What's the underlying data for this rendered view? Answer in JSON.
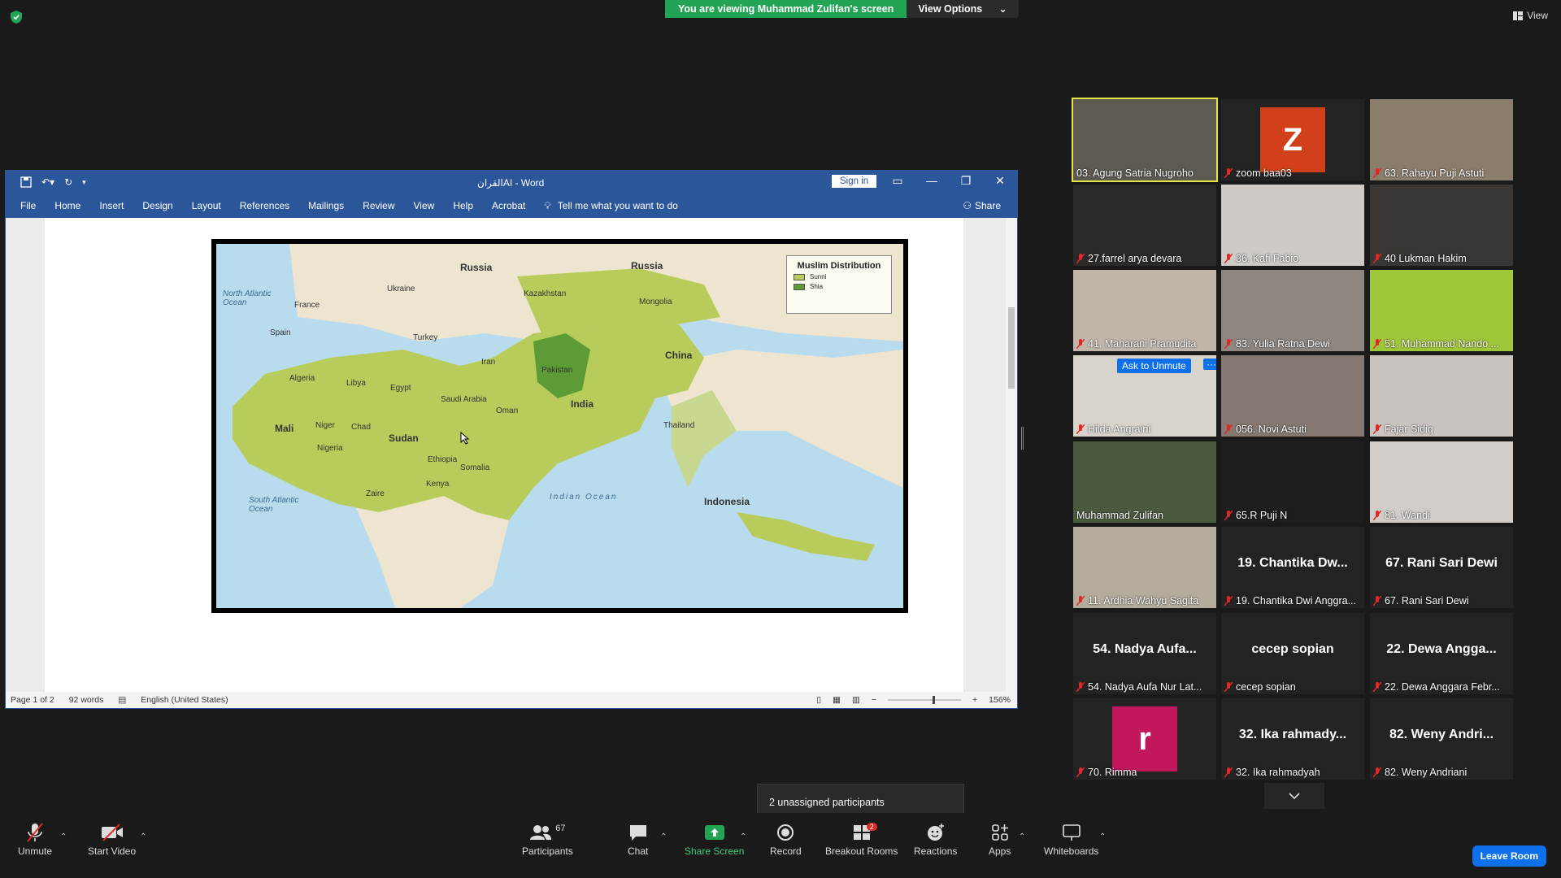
{
  "zoom": {
    "banner": "You are viewing Muhammad Zulifan's screen",
    "view_options": "View Options",
    "view_label": "View",
    "unassigned": "2 unassigned participants"
  },
  "word": {
    "title": "القرانAI  -  Word",
    "sign_in": "Sign in",
    "tabs": [
      "File",
      "Home",
      "Insert",
      "Design",
      "Layout",
      "References",
      "Mailings",
      "Review",
      "View",
      "Help",
      "Acrobat"
    ],
    "tell_me": "Tell me what you want to do",
    "share": "Share",
    "status": {
      "page": "Page 1 of 2",
      "words": "92 words",
      "language": "English (United States)",
      "zoom": "156%"
    },
    "map": {
      "legend_title": "Muslim Distribution",
      "legend_items": [
        {
          "label": "Sunni",
          "color": "#b7cc5a"
        },
        {
          "label": "Shia",
          "color": "#5c9b36"
        }
      ],
      "labels": {
        "russia1": "Russia",
        "russia2": "Russia",
        "kazakhstan": "Kazakhstan",
        "mongolia": "Mongolia",
        "china": "China",
        "ukraine": "Ukraine",
        "turkey": "Turkey",
        "iran": "Iran",
        "saudi": "Saudi Arabia",
        "india": "India",
        "algeria": "Algeria",
        "libya": "Libya",
        "egypt": "Egypt",
        "mali": "Mali",
        "niger": "Niger",
        "chad": "Chad",
        "sudan": "Sudan",
        "ethiopia": "Ethiopia",
        "somalia": "Somalia",
        "zaire": "Zaire",
        "indonesia": "Indonesia",
        "indian_ocean": "Indian Ocean",
        "north_atlantic": "North Atlantic Ocean",
        "south_atlantic": "South Atlantic Ocean",
        "thailand": "Thailand",
        "nigeria": "Nigeria",
        "oman": "Oman",
        "pakistan": "Pakistan",
        "spain": "Spain",
        "france": "France",
        "kenya": "Kenya"
      }
    }
  },
  "participants": [
    {
      "name": "03. Agung Satria Nugroho",
      "muted": false,
      "active": true,
      "video": "#5e5a52"
    },
    {
      "name": "zoom baa03",
      "muted": true,
      "avatar": "Z",
      "avatar_color": "#d1401a"
    },
    {
      "name": "63. Rahayu Puji Astuti",
      "muted": true,
      "video": "#8b7d6c"
    },
    {
      "name": "27.farrel arya devara",
      "muted": true,
      "video": "#2c2a29"
    },
    {
      "name": "36. Kafi Fabio",
      "muted": true,
      "video": "#cfcac6"
    },
    {
      "name": "40 Lukman Hakim",
      "muted": true,
      "video": "#3a3633"
    },
    {
      "name": "41. Maharani Pramudita",
      "muted": true,
      "video": "#c2b6aa"
    },
    {
      "name": "83. Yulia Ratna Dewi",
      "muted": true,
      "video": "#8e8680"
    },
    {
      "name": "51. Muhammad Nando ...",
      "muted": true,
      "video": "#9fc73a"
    },
    {
      "name": "Hilda Angraini",
      "muted": true,
      "video": "#d8d4cc",
      "ask": "Ask to Unmute",
      "ask_more": "···"
    },
    {
      "name": "056. Novi Astuti",
      "muted": true,
      "video": "#857870"
    },
    {
      "name": "Fajar Sidiq",
      "muted": true,
      "video": "#cac4c1"
    },
    {
      "name": "Muhammad Zulifan",
      "muted": false,
      "video": "#4b5a3e"
    },
    {
      "name": "65.R Puji N",
      "muted": true,
      "video": "#1e1e1e"
    },
    {
      "name": "81. Wandi",
      "muted": true,
      "video": "#d2ccc9"
    },
    {
      "name": "11. Ardhia Wahyu Sagita",
      "muted": true,
      "video": "#b3ab9b"
    },
    {
      "name": "19. Chantika Dwi Anggra...",
      "muted": true,
      "big": "19. Chantika Dw..."
    },
    {
      "name": "67. Rani Sari Dewi",
      "muted": true,
      "big": "67. Rani Sari Dewi"
    },
    {
      "name": "54. Nadya Aufa Nur Lat...",
      "muted": true,
      "big": "54. Nadya Aufa..."
    },
    {
      "name": "cecep sopian",
      "muted": true,
      "big": "cecep sopian"
    },
    {
      "name": "22. Dewa Anggara Febr...",
      "muted": true,
      "big": "22. Dewa Angga..."
    },
    {
      "name": "70. Rimma",
      "muted": true,
      "avatar": "r",
      "avatar_color": "#c2185b"
    },
    {
      "name": "32. Ika rahmadyah",
      "muted": true,
      "big": "32. Ika rahmady..."
    },
    {
      "name": "82. Weny Andriani",
      "muted": true,
      "big": "82. Weny Andri..."
    }
  ],
  "toolbar": {
    "unmute": "Unmute",
    "start_video": "Start Video",
    "participants": "Participants",
    "participants_count": "67",
    "chat": "Chat",
    "share_screen": "Share Screen",
    "record": "Record",
    "breakout": "Breakout Rooms",
    "breakout_badge": "2",
    "reactions": "Reactions",
    "apps": "Apps",
    "whiteboards": "Whiteboards",
    "leave": "Leave Room"
  }
}
